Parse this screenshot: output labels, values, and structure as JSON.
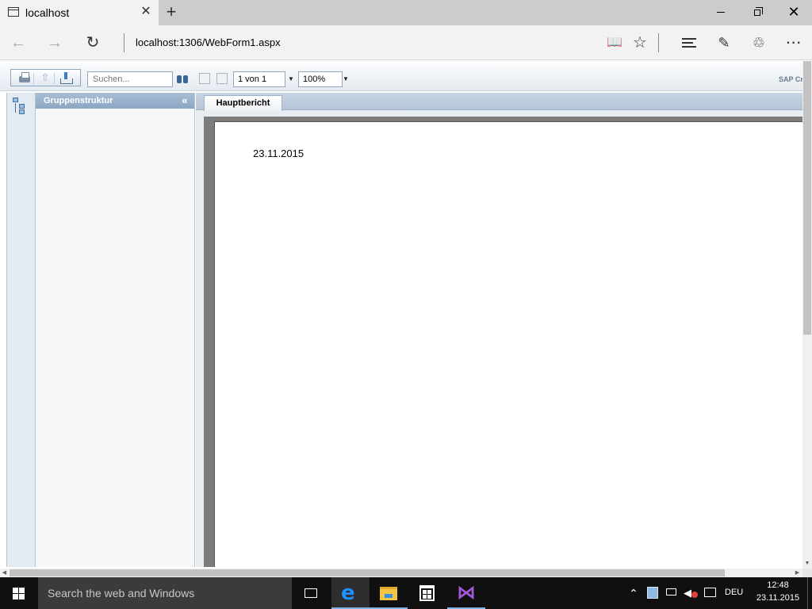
{
  "browser": {
    "tab_title": "localhost",
    "tab_close": "✕",
    "new_tab": "+",
    "address": "localhost:1306/WebForm1.aspx",
    "window_close": "✕",
    "nav_back": "←",
    "nav_forward": "→",
    "nav_refresh": "↻",
    "reading_view": "📖",
    "favorite": "☆",
    "notes": "✎",
    "share": "♲",
    "more": "⋯"
  },
  "viewer_toolbar": {
    "search_placeholder": "Suchen...",
    "page_selector": "1 von 1",
    "zoom": "100%",
    "dropdown_arrow": "▼",
    "brand_text": "SAP Crystal Reports"
  },
  "group_panel": {
    "title": "Gruppenstruktur",
    "collapse": "«"
  },
  "report": {
    "tab_label": "Hauptbericht",
    "date": "23.11.2015"
  },
  "scrollbars": {
    "up_arrow": "▲",
    "down_arrow": "▼",
    "left_arrow": "◀",
    "right_arrow": "▶"
  },
  "taskbar": {
    "search_text": "Search the web and Windows",
    "edge_glyph": "e",
    "vs_glyph": "⋈",
    "tray_chevron": "⌃",
    "volume_glyph": "◀",
    "language": "DEU",
    "time": "12:48",
    "date": "23.11.2015"
  },
  "colors": {
    "accent_blue": "#3b6597",
    "panel_header": "#8ba6c3",
    "taskbar": "#101010",
    "edge_blue": "#1e90ff",
    "vs_purple": "#a45ad8"
  }
}
